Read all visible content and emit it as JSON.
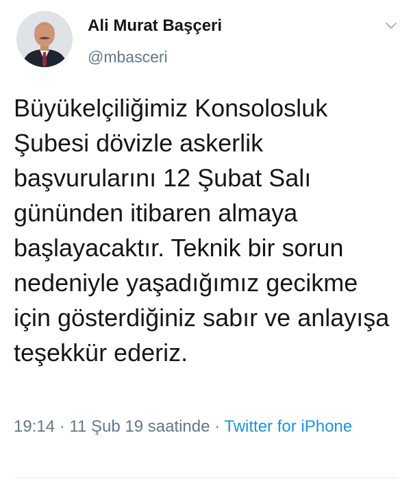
{
  "author": {
    "display_name": "Ali Murat Başçeri",
    "handle": "@mbasceri",
    "avatar_icon": "profile-photo"
  },
  "menu": {
    "icon": "chevron-down-icon"
  },
  "tweet": {
    "text": "Büyükelçiliğimiz Konsolosluk Şubesi dövizle askerlik başvurularını 12 Şubat Salı gününden itibaren almaya başlayacaktır. Teknik bir sorun nedeniyle yaşadığımız gecikme için gösterdiğiniz sabır ve anlayışa teşekkür ederiz."
  },
  "meta": {
    "time": "19:14",
    "separator": "·",
    "date": "11 Şub 19 saatinde",
    "source": "Twitter for iPhone"
  },
  "colors": {
    "text": "#14171a",
    "secondary": "#657786",
    "link": "#1b95e0",
    "divider": "#e6ecf0"
  }
}
